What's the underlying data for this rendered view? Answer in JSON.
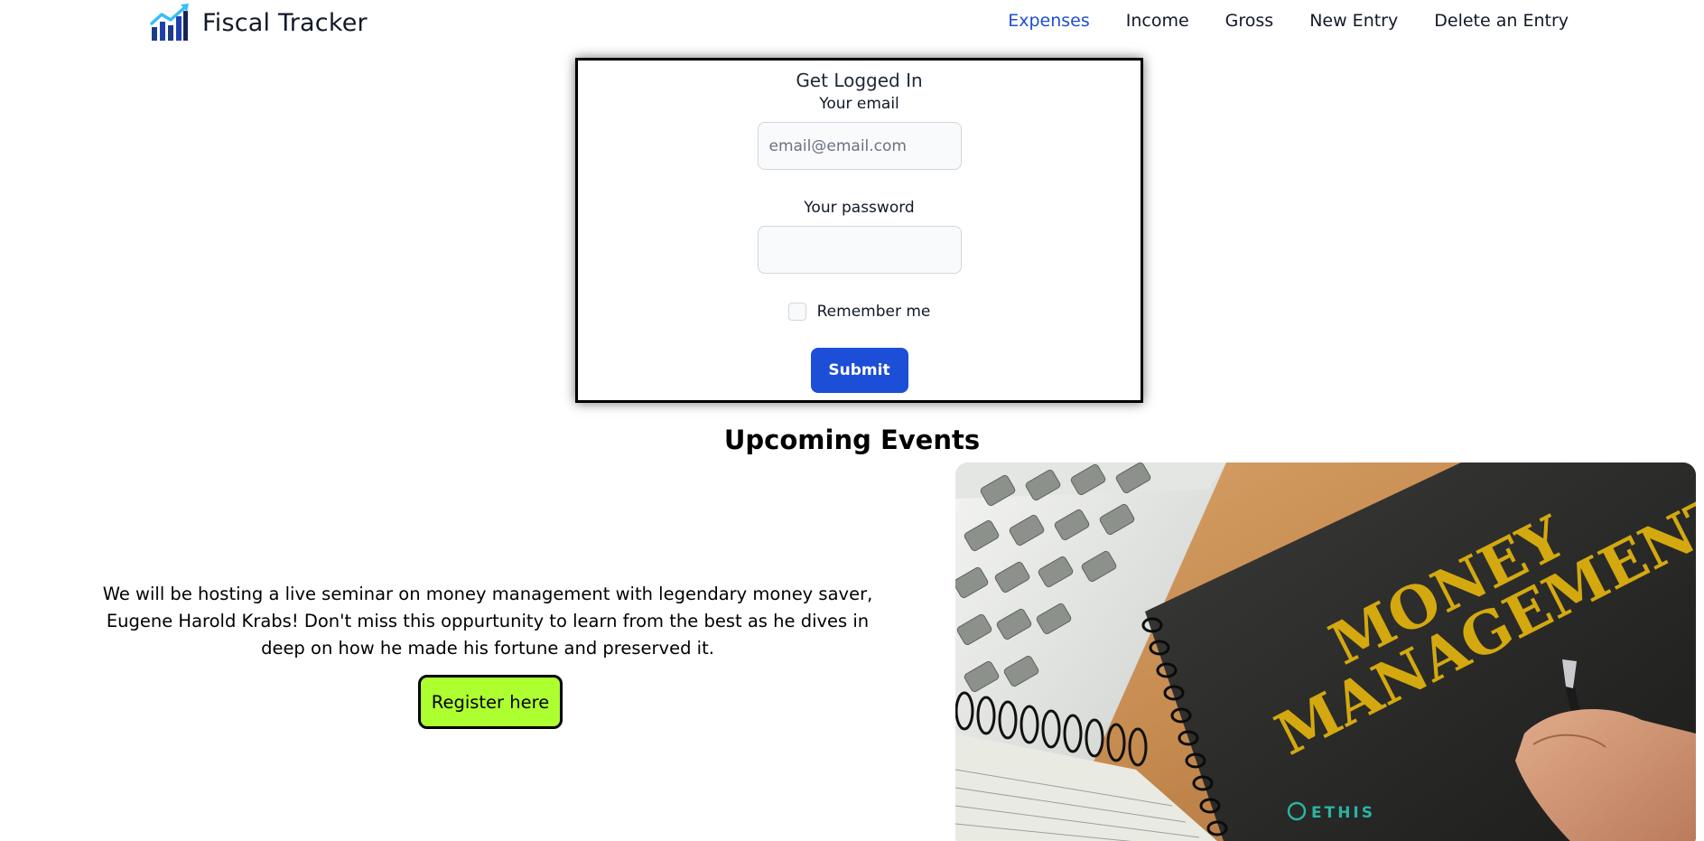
{
  "navbar": {
    "brand_name": "Fiscal Tracker",
    "brand_icon": "rising-bar-chart-icon",
    "links": [
      {
        "label": "Expenses",
        "active": true
      },
      {
        "label": "Income",
        "active": false
      },
      {
        "label": "Gross",
        "active": false
      },
      {
        "label": "New Entry",
        "active": false
      },
      {
        "label": "Delete an Entry",
        "active": false
      }
    ]
  },
  "login": {
    "title": "Get Logged In",
    "email_label": "Your email",
    "email_placeholder": "email@email.com",
    "email_value": "",
    "password_label": "Your password",
    "password_value": "",
    "remember_label": "Remember me",
    "remember_checked": false,
    "submit_label": "Submit"
  },
  "events": {
    "heading": "Upcoming Events",
    "description": "We will be hosting a live seminar on money management with legendary money saver, Eugene Harold Krabs! Don't miss this oppurtunity to learn from the best as he dives in deep on how he made his fortune and preserved it.",
    "register_label": "Register here",
    "image": {
      "subject": "money-management-notebook-photo",
      "headline_line1": "MONEY",
      "headline_line2": "MANAGEMENT",
      "watermark": "ETHIS"
    }
  },
  "colors": {
    "accent_blue": "#1d4ed8",
    "register_green": "#adff2f",
    "notebook_gold": "#d4a90f"
  }
}
